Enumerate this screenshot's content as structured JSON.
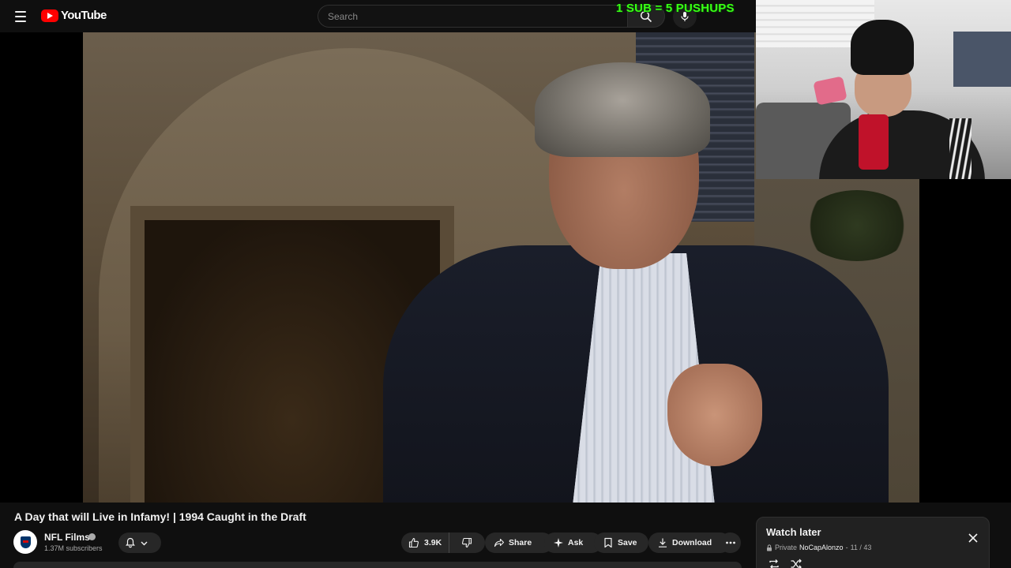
{
  "header": {
    "logo_text": "YouTube",
    "search_placeholder": "Search"
  },
  "stream_overlay": {
    "text": "1 SUB = 5 PUSHUPS",
    "color": "#39ff14"
  },
  "video": {
    "title": "A Day that will Live in Infamy! | 1994 Caught in the Draft"
  },
  "channel": {
    "name": "NFL Films",
    "subscribers": "1.37M subscribers",
    "avatar_icon": "nfl-films-logo"
  },
  "actions": {
    "likes": "3.9K",
    "share_label": "Share",
    "ask_label": "Ask",
    "save_label": "Save",
    "download_label": "Download"
  },
  "playlist": {
    "title": "Watch later",
    "privacy": "Private",
    "owner": "NoCapAlonzo",
    "position": "11 / 43"
  },
  "colors": {
    "brand_red": "#ff0000",
    "background": "#0f0f0f",
    "pill_bg": "#272727"
  }
}
